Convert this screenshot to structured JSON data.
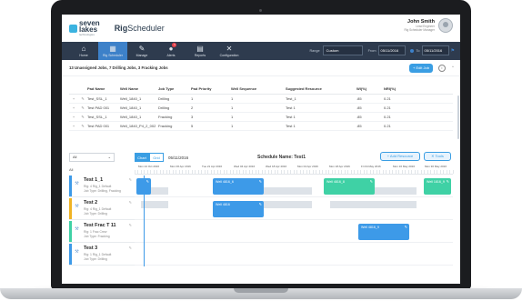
{
  "header": {
    "logo_line1": "seven",
    "logo_line2": "lakes",
    "logo_sub": "technologies",
    "app_prefix": "Rig",
    "app_suffix": "Scheduler",
    "user_name": "John Smith",
    "user_role1": "Lead Engineer",
    "user_role2": "Rig Scheduler Manager"
  },
  "nav": {
    "items": [
      {
        "icon": "⌂",
        "label": "Home"
      },
      {
        "icon": "▦",
        "label": "Rig Scheduler"
      },
      {
        "icon": "✎",
        "label": "Manage"
      },
      {
        "icon": "●",
        "label": "Alerts",
        "badge": "1"
      },
      {
        "icon": "▤",
        "label": "Reports"
      },
      {
        "icon": "✕",
        "label": "Configuration"
      }
    ],
    "range_label": "Range",
    "range_value": "Custom",
    "from_label": "From",
    "from_value": "05/11/2016",
    "to_label": "To",
    "to_value": "05/11/2016"
  },
  "jobs": {
    "summary": "13 Unassigned Jobs, 7 Drilling Jobs, 3 Fracking Jobs",
    "edit_label": "+ Edit Job",
    "info": "i",
    "collapse": "^",
    "columns": [
      "Pad Name",
      "Well Name",
      "Job Type",
      "Pad Priority",
      "Well Sequence",
      "Suggested Resource",
      "Wl(%)",
      "NRI(%)"
    ],
    "rows": [
      {
        "expand": "+",
        "edit": "✎",
        "pad": "Test_SSL_1",
        "well": "Well_1840_1",
        "type": "Drilling",
        "priority": "1",
        "seq": "1",
        "res": "Test_1",
        "wi": ".85",
        "nri": "0.21"
      },
      {
        "expand": "+",
        "edit": "✎",
        "pad": "Test PAD 001",
        "well": "Well_1840_1",
        "type": "Drilling",
        "priority": "2",
        "seq": "1",
        "res": "Test 1",
        "wi": ".85",
        "nri": "0.21"
      },
      {
        "expand": "+",
        "edit": "✎",
        "pad": "Test_SSL_1",
        "well": "Well_1840_1",
        "type": "Fracking",
        "priority": "3",
        "seq": "1",
        "res": "Test 1",
        "wi": ".85",
        "nri": "0.21"
      },
      {
        "expand": "+",
        "edit": "✎",
        "pad": "Test PAD 001",
        "well": "Well_1840_P4_2_002",
        "type": "Fracking",
        "priority": "5",
        "seq": "1",
        "res": "Test 1",
        "wi": ".85",
        "nri": "0.21"
      }
    ]
  },
  "schedule": {
    "filter": "All",
    "view_chart": "Chart",
    "view_grid": "Grid",
    "date": "05/11/2016",
    "name": "Schedule Name: Test1",
    "add_resource": "+ Add Resource",
    "tools": "✕ Tools",
    "all_label": "All",
    "timeline": [
      "Mon 24 Oct 2016",
      "Mon 06 Apr 2016",
      "Tue 21 Apr 2016",
      "Wed 04 Apr 2016",
      "Wed 18 Apr 2016",
      "Mon 04 Apr 2016",
      "Mon 18 Apr 2016",
      "Fri 04 May 2016",
      "Mon 16 May 2016",
      "Mon 30 May 2016"
    ],
    "resources": [
      {
        "name": "Test 1_1",
        "d1": "Rig: 4 Rig_1 Default",
        "d2": "Job Type: Drilling, Fracking",
        "color": "#3d9ae8"
      },
      {
        "name": "Test 2",
        "d1": "Rig: 4 Rig_1 Default",
        "d2": "Job Type: Drilling",
        "color": "#f0b323"
      },
      {
        "name": "Test Frac T 11",
        "d1": "Rig: 1 Frac Crew",
        "d2": "Job Type: Fracking",
        "color": "#3fd1a5"
      },
      {
        "name": "Test 3",
        "d1": "Rig: 1 Rig_1 Default",
        "d2": "Job Type: Drilling",
        "color": "#3d9ae8"
      }
    ],
    "jobs": [
      {
        "label": "",
        "color": "blue"
      },
      {
        "label": "Well 4816_6",
        "color": "blue"
      },
      {
        "label": "Well 4816_8",
        "color": "green"
      },
      {
        "label": "Well 4816",
        "color": "blue"
      },
      {
        "label": "Well 4816_9",
        "color": "blue"
      },
      {
        "label": "Well 1816_9",
        "color": "green"
      }
    ]
  }
}
